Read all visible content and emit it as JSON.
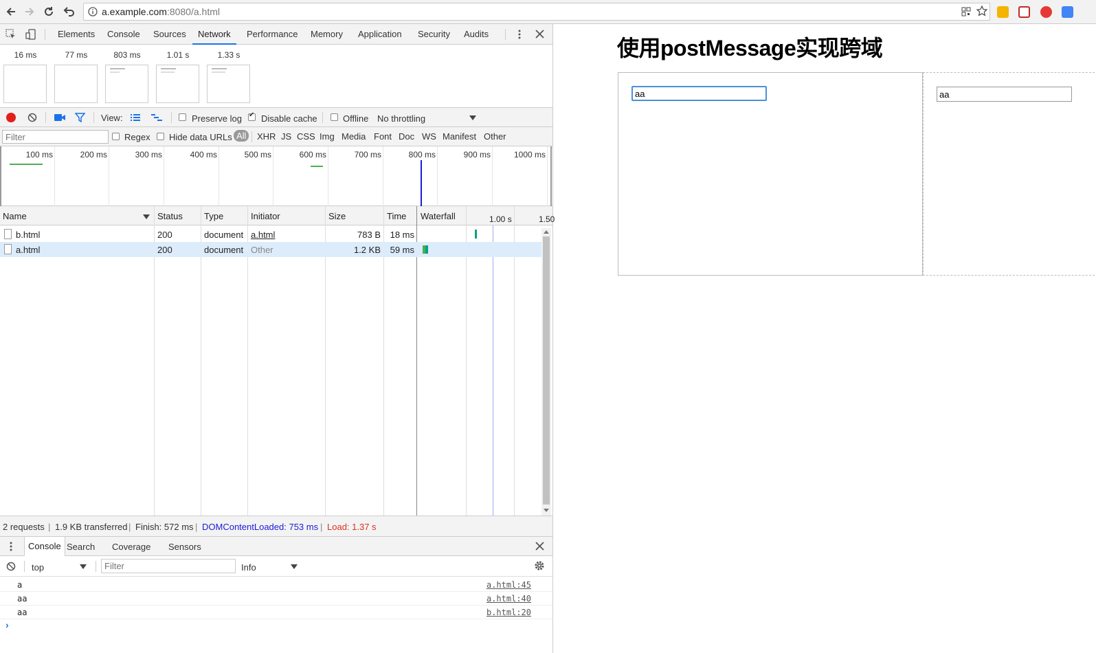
{
  "browser": {
    "url_host": "a.example.com",
    "url_rest": ":8080/a.html"
  },
  "devtools": {
    "tabs": [
      "Elements",
      "Console",
      "Sources",
      "Network",
      "Performance",
      "Memory",
      "Application",
      "Security",
      "Audits"
    ],
    "active_tab": "Network",
    "filmstrip": [
      "16 ms",
      "77 ms",
      "803 ms",
      "1.01 s",
      "1.33 s"
    ],
    "toolbar": {
      "view_label": "View:",
      "preserve_log": "Preserve log",
      "disable_cache": "Disable cache",
      "offline": "Offline",
      "throttling": "No throttling"
    },
    "filter": {
      "placeholder": "Filter",
      "regex": "Regex",
      "hide_data_urls": "Hide data URLs",
      "types": [
        "All",
        "XHR",
        "JS",
        "CSS",
        "Img",
        "Media",
        "Font",
        "Doc",
        "WS",
        "Manifest",
        "Other"
      ]
    },
    "overview_ticks": [
      "100 ms",
      "200 ms",
      "300 ms",
      "400 ms",
      "500 ms",
      "600 ms",
      "700 ms",
      "800 ms",
      "900 ms",
      "1000 ms"
    ],
    "table": {
      "headers": {
        "name": "Name",
        "status": "Status",
        "type": "Type",
        "initiator": "Initiator",
        "size": "Size",
        "time": "Time",
        "waterfall": "Waterfall",
        "wf_tick1": "1.00 s",
        "wf_tick2": "1.50"
      },
      "rows": [
        {
          "name": "b.html",
          "status": "200",
          "type": "document",
          "initiator": "a.html",
          "size": "783 B",
          "time": "18 ms"
        },
        {
          "name": "a.html",
          "status": "200",
          "type": "document",
          "initiator": "Other",
          "size": "1.2 KB",
          "time": "59 ms"
        }
      ]
    },
    "summary": {
      "requests": "2 requests",
      "transferred": "1.9 KB transferred",
      "finish": "Finish: 572 ms",
      "dcl": "DOMContentLoaded: 753 ms",
      "load": "Load: 1.37 s"
    },
    "drawer": {
      "tabs": [
        "Console",
        "Search",
        "Coverage",
        "Sensors"
      ],
      "context": "top",
      "filter_placeholder": "Filter",
      "level": "Info",
      "messages": [
        {
          "text": "a",
          "source": "a.html:45"
        },
        {
          "text": "aa",
          "source": "a.html:40"
        },
        {
          "text": "aa",
          "source": "b.html:20"
        }
      ],
      "prompt": "›"
    }
  },
  "page": {
    "title": "使用postMessage实现跨域",
    "input_a": "aa",
    "input_b": "aa"
  },
  "colors": {
    "accent": "#1a73e8",
    "record": "#e0201b",
    "dcl": "#1a1adb",
    "load": "#d93025"
  }
}
